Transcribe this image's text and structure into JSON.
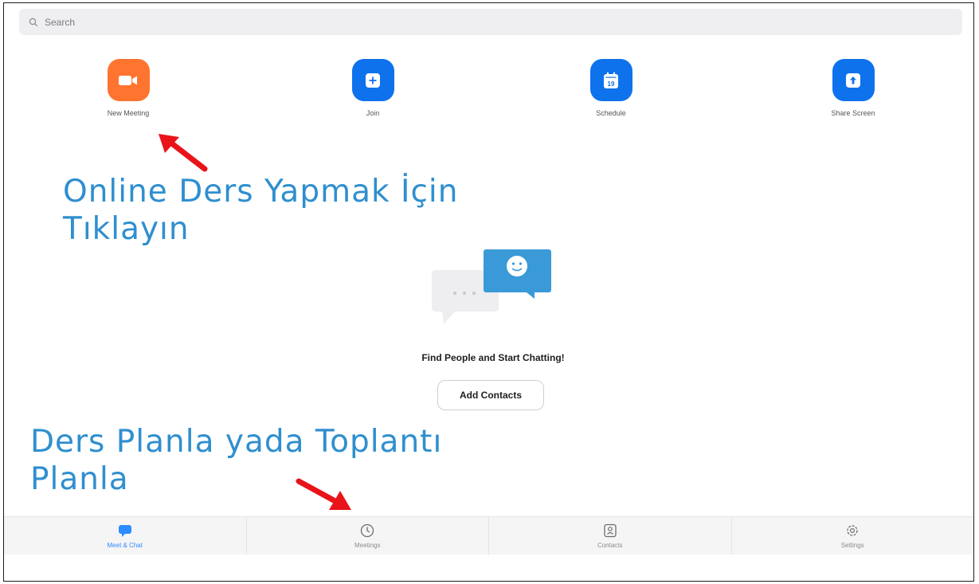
{
  "search": {
    "placeholder": "Search"
  },
  "actions": [
    {
      "label": "New Meeting",
      "icon": "video-camera-icon",
      "color": "#ff742e"
    },
    {
      "label": "Join",
      "icon": "plus-icon",
      "color": "#0e72ed"
    },
    {
      "label": "Schedule",
      "icon": "calendar-icon",
      "color": "#0e72ed",
      "calendar_day": "19"
    },
    {
      "label": "Share Screen",
      "icon": "upload-arrow-icon",
      "color": "#0e72ed"
    }
  ],
  "annotations": {
    "top_line1": "Online Ders Yapmak İçin",
    "top_line2": "Tıklayın",
    "bottom_line1": "Ders Planla yada Toplantı",
    "bottom_line2": "Planla",
    "color": "#2f8fcf",
    "arrow_color": "#e8141a"
  },
  "empty_state": {
    "title": "Find People and Start Chatting!",
    "button": "Add Contacts",
    "illustration": "chat-bubbles-illustration"
  },
  "tabs": [
    {
      "label": "Meet & Chat",
      "icon": "chat-bubble-icon",
      "active": true
    },
    {
      "label": "Meetings",
      "icon": "clock-icon",
      "active": false
    },
    {
      "label": "Contacts",
      "icon": "contact-card-icon",
      "active": false
    },
    {
      "label": "Settings",
      "icon": "gear-icon",
      "active": false
    }
  ],
  "colors": {
    "accent": "#2d8cff",
    "orange": "#ff742e",
    "blue": "#0e72ed"
  }
}
